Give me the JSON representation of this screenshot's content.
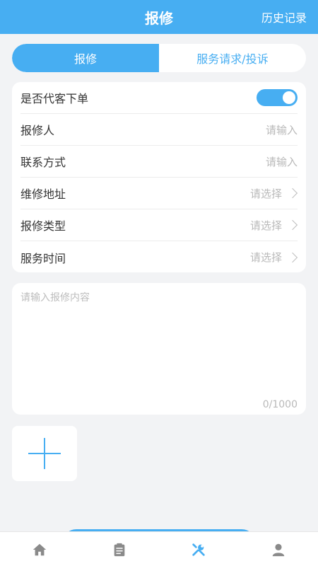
{
  "header": {
    "title": "报修",
    "history_label": "历史记录"
  },
  "tabs": [
    {
      "label": "报修",
      "active": true
    },
    {
      "label": "服务请求/投诉",
      "active": false
    }
  ],
  "form": {
    "proxy_order": {
      "label": "是否代客下单",
      "enabled": true
    },
    "reporter": {
      "label": "报修人",
      "placeholder": "请输入"
    },
    "contact": {
      "label": "联系方式",
      "placeholder": "请输入"
    },
    "address": {
      "label": "维修地址",
      "placeholder": "请选择"
    },
    "repair_type": {
      "label": "报修类型",
      "placeholder": "请选择"
    },
    "service_time": {
      "label": "服务时间",
      "placeholder": "请选择"
    }
  },
  "content": {
    "placeholder": "请输入报修内容",
    "counter": "0/1000"
  },
  "bottom_nav": [
    {
      "icon": "home-icon",
      "active": false
    },
    {
      "icon": "clipboard-icon",
      "active": false
    },
    {
      "icon": "wrench-icon",
      "active": true
    },
    {
      "icon": "user-icon",
      "active": false
    }
  ],
  "colors": {
    "primary": "#47aef2",
    "background": "#f2f3f5",
    "nav_inactive": "#8a8a8a"
  }
}
